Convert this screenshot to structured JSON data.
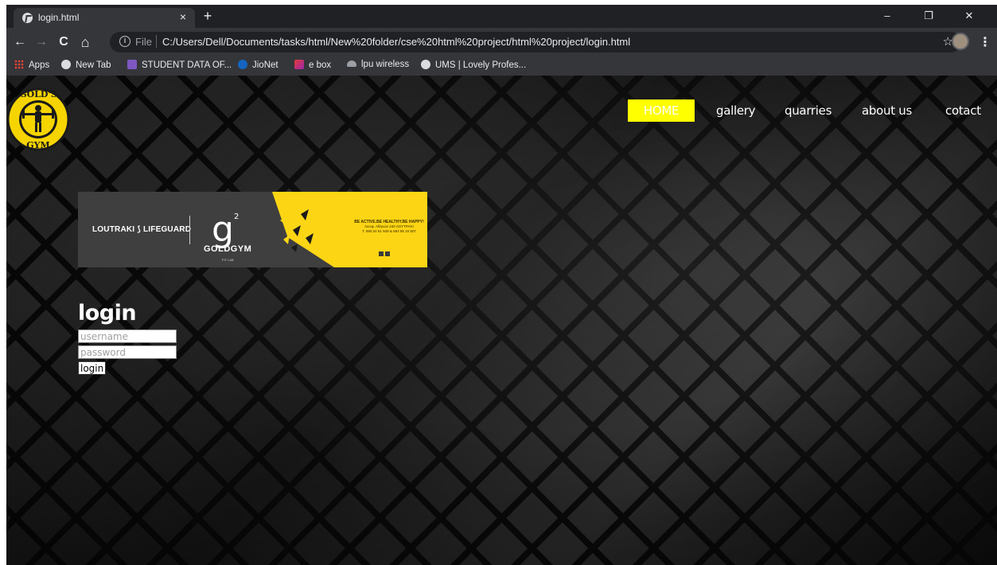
{
  "browser": {
    "tab_title": "login.html",
    "tab_close": "×",
    "new_tab": "+",
    "window_minimize": "–",
    "window_restore": "❐",
    "window_close": "✕",
    "nav_back": "←",
    "nav_forward": "→",
    "nav_reload": "C",
    "nav_home": "⌂",
    "address_scheme": "File",
    "address_url": "C:/Users/Dell/Documents/tasks/html/New%20folder/cse%20html%20project/html%20project/login.html",
    "bookmark_star": "☆",
    "menu": "⋮"
  },
  "bookmarks": [
    {
      "label": "Apps",
      "icon": "apps-grid-icon"
    },
    {
      "label": "New Tab",
      "icon": "chrome-icon"
    },
    {
      "label": "STUDENT DATA OF...",
      "icon": "sheet-icon"
    },
    {
      "label": "JioNet",
      "icon": "jio-icon"
    },
    {
      "label": "e box",
      "icon": "ebox-icon"
    },
    {
      "label": "lpu wireless",
      "icon": "cloud-icon"
    },
    {
      "label": "UMS | Lovely Profes...",
      "icon": "chrome-icon"
    }
  ],
  "page": {
    "logo_alt": "GOLD'S GYM",
    "nav": {
      "home": "HOME",
      "gallery": "gallery",
      "quarries": "quarries",
      "about": "about us",
      "contact": "cotact"
    },
    "banner": {
      "lifeguard": "LOUTRAKI ⟆ LIFEGUARD",
      "g2": "g",
      "g2_sup": "2",
      "goldgym": "GOLDGYM",
      "fitlab": "FIT LAB",
      "promo_line1": "BE ACTIVE.BE HEALTHY.BE HAPPY!",
      "promo_line2": "Λεωφ. Αθηνών 240 ΛΟΥΤΡΑΚΙ",
      "promo_line3": "T. 690 04 61 949 & 693 95 15 507"
    },
    "login": {
      "title": "login",
      "username_placeholder": "username",
      "password_placeholder": "password",
      "button": "login"
    }
  },
  "colors": {
    "nav_active_bg": "#ffff00",
    "banner_yellow": "#fcd515",
    "banner_dark": "#3f3f3f",
    "logo_yellow": "#f5d400"
  }
}
